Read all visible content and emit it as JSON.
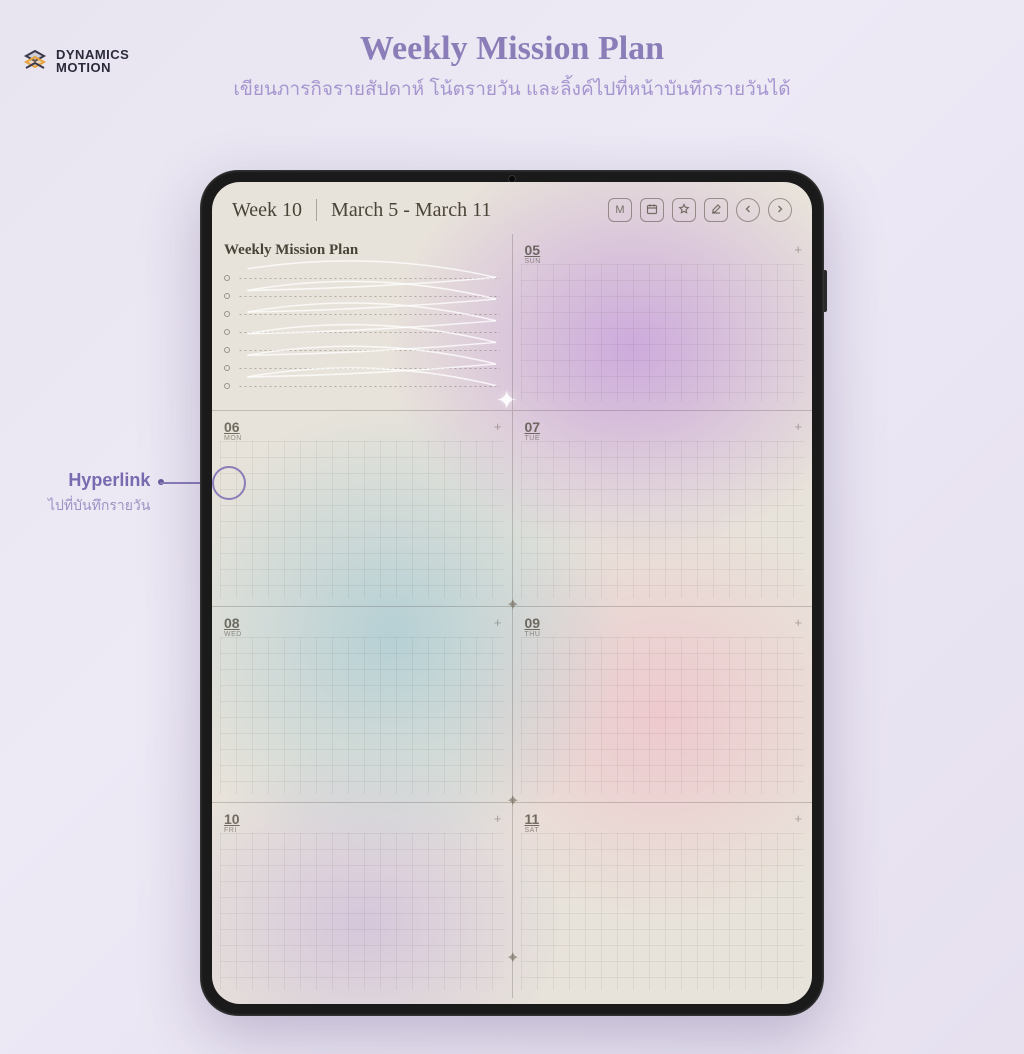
{
  "brand": {
    "line1": "DYNAMICS",
    "line2": "MOTION"
  },
  "heading": {
    "title": "Weekly Mission Plan",
    "subtitle": "เขียนภารกิจรายสัปดาห์  โน้ตรายวัน และลิ้งค์ไปที่หน้าบันทึกรายวันได้"
  },
  "callout": {
    "title": "Hyperlink",
    "sub": "ไปที่บันทึกรายวัน"
  },
  "header": {
    "week": "Week 10",
    "dateRange": "March 5  -  March 11",
    "buttons": {
      "month": "M"
    }
  },
  "missionPlan": {
    "title": "Weekly Mission Plan",
    "lineCount": 7
  },
  "days": [
    {
      "num": "05",
      "dow": "SUN"
    },
    {
      "num": "06",
      "dow": "MON"
    },
    {
      "num": "07",
      "dow": "TUE"
    },
    {
      "num": "08",
      "dow": "WED"
    },
    {
      "num": "09",
      "dow": "THU"
    },
    {
      "num": "10",
      "dow": "FRI"
    },
    {
      "num": "11",
      "dow": "SAT"
    }
  ]
}
